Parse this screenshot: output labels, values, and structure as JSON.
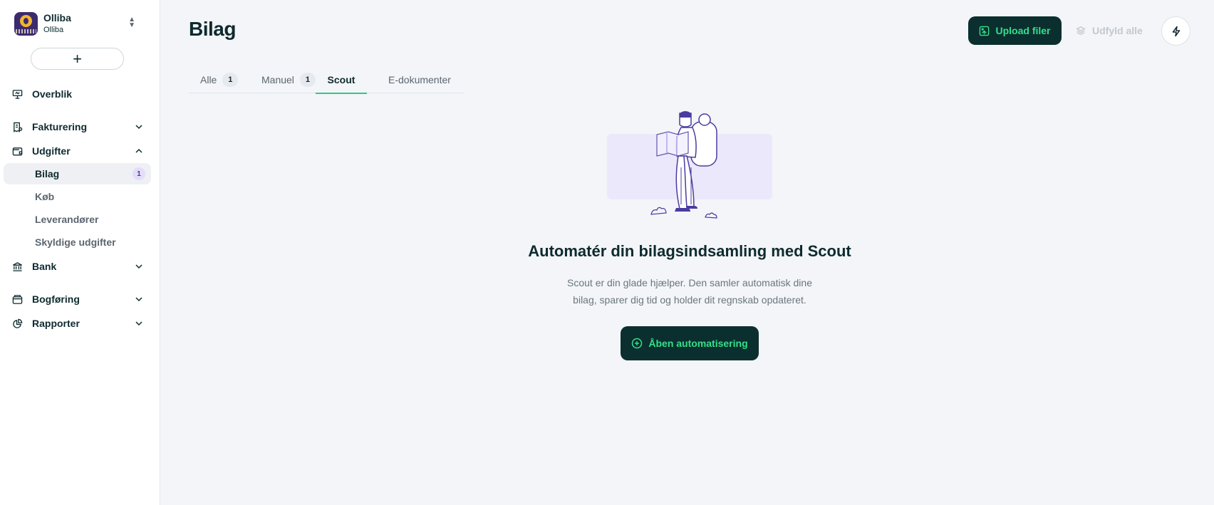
{
  "org": {
    "name": "Olliba",
    "subtitle": "Olliba"
  },
  "sidebar": {
    "add_label": "+",
    "items": [
      {
        "label": "Overblik",
        "icon": "presentation-icon"
      },
      {
        "label": "Fakturering",
        "icon": "invoice-icon",
        "expanded": false
      },
      {
        "label": "Udgifter",
        "icon": "wallet-icon",
        "expanded": true,
        "children": [
          {
            "label": "Bilag",
            "badge": "1",
            "active": true
          },
          {
            "label": "Køb"
          },
          {
            "label": "Leverandører"
          },
          {
            "label": "Skyldige udgifter"
          }
        ]
      },
      {
        "label": "Bank",
        "icon": "bank-icon",
        "expanded": false
      },
      {
        "label": "Bogføring",
        "icon": "ledger-icon",
        "expanded": false
      },
      {
        "label": "Rapporter",
        "icon": "pie-chart-icon",
        "expanded": false
      }
    ]
  },
  "header": {
    "title": "Bilag",
    "upload_label": "Upload filer",
    "fill_all_label": "Udfyld alle"
  },
  "tabs": [
    {
      "label": "Alle",
      "count": "1"
    },
    {
      "label": "Manuel",
      "count": "1"
    },
    {
      "label": "Scout",
      "active": true
    },
    {
      "label": "E-dokumenter"
    }
  ],
  "empty_state": {
    "title": "Automatér din bilagsindsamling med Scout",
    "line1": "Scout er din glade hjælper. Den samler automatisk dine",
    "line2": "bilag, sparer dig tid og holder dit regnskab opdateret.",
    "cta_label": "Åben automatisering"
  },
  "colors": {
    "accent_green": "#33e08a",
    "dark_button": "#0b2f2f",
    "badge_purple": "#e3dcfa",
    "tab_underline": "#2cc985"
  }
}
